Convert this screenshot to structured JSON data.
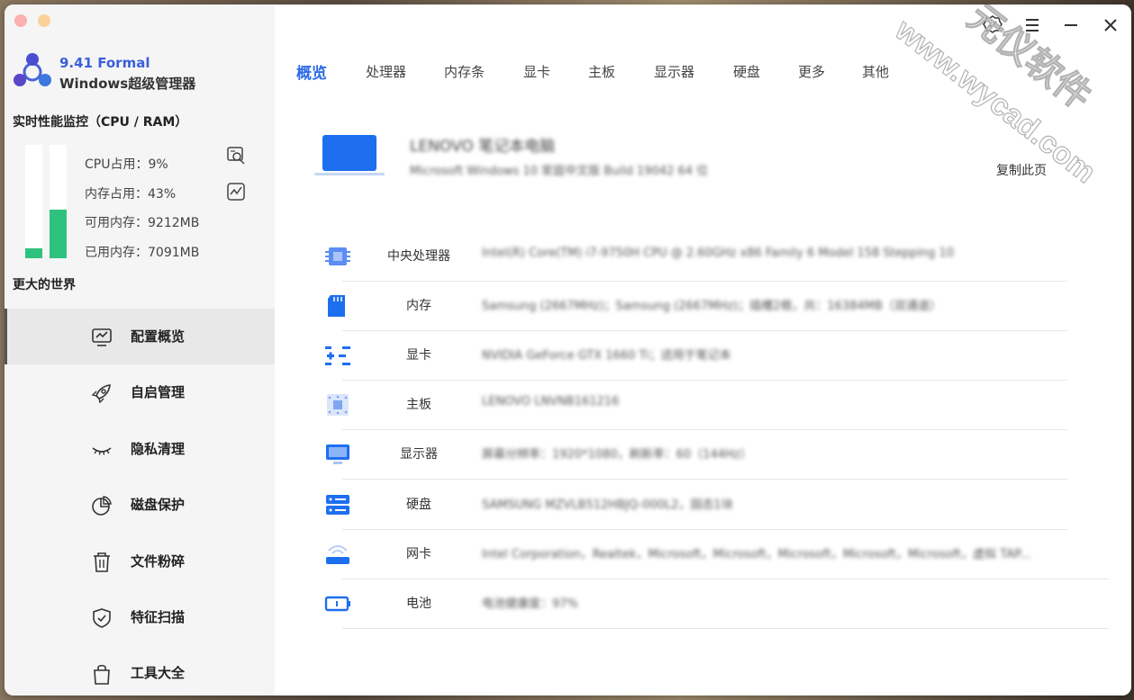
{
  "app": {
    "version": "9.41 Formal",
    "name": "Windows超级管理器"
  },
  "monitor": {
    "title": "实时性能监控（CPU / RAM）",
    "cpu": "CPU占用：9%",
    "mem": "内存占用：43%",
    "avail": "可用内存：9212MB",
    "used": "已用内存：7091MB",
    "cpu_fraction": 0.09,
    "mem_fraction": 0.43
  },
  "bigger_world": "更大的世界",
  "nav": [
    {
      "label": "配置概览",
      "icon": "monitor-chart-icon"
    },
    {
      "label": "自启管理",
      "icon": "rocket-icon"
    },
    {
      "label": "隐私清理",
      "icon": "closed-eye-icon"
    },
    {
      "label": "磁盘保护",
      "icon": "pie-chart-icon"
    },
    {
      "label": "文件粉碎",
      "icon": "trash-icon"
    },
    {
      "label": "特征扫描",
      "icon": "shield-check-icon"
    },
    {
      "label": "工具大全",
      "icon": "bag-icon"
    }
  ],
  "tabs": [
    "概览",
    "处理器",
    "内存条",
    "显卡",
    "主板",
    "显示器",
    "硬盘",
    "更多",
    "其他"
  ],
  "device": {
    "model": "LENOVO 笔记本电脑",
    "os": "Microsoft Windows 10 家庭中文版 Build 19042 64 位",
    "copy_label": "复制此页"
  },
  "rows": [
    {
      "label": "中央处理器",
      "value": "Intel(R) Core(TM) i7-9750H CPU @ 2.60GHz x86 Family 6 Model 158 Stepping 10",
      "icon": "cpu-icon"
    },
    {
      "label": "内存",
      "value": "Samsung (2667MHz)；Samsung (2667MHz)；插槽2根，共：16384MB（双通道）",
      "icon": "sd-card-icon"
    },
    {
      "label": "显卡",
      "value": "NVIDIA GeForce GTX 1660 Ti；适用于笔记本",
      "icon": "gpu-icon"
    },
    {
      "label": "主板",
      "value": "LENOVO LNVNB161216",
      "icon": "motherboard-icon"
    },
    {
      "label": "显示器",
      "value": "屏幕分辨率：1920*1080，刷新率：60（144Hz）",
      "icon": "display-icon"
    },
    {
      "label": "硬盘",
      "value": "SAMSUNG MZVLB512HBJQ-000L2，固态1块",
      "icon": "hard-disk-icon"
    },
    {
      "label": "网卡",
      "value": "Intel Corporation，Realtek，Microsoft，Microsoft，Microsoft，Microsoft，Microsoft，虚拟 TAP...",
      "icon": "wifi-icon"
    },
    {
      "label": "电池",
      "value": "电池健康度：97%",
      "icon": "battery-icon"
    }
  ],
  "watermark": {
    "line1": "元仪软件",
    "line2": "www.wycad.com"
  },
  "colors": {
    "accent": "#2d6be6",
    "green": "#2ec27e",
    "icon_blue": "#1e6ff0"
  }
}
